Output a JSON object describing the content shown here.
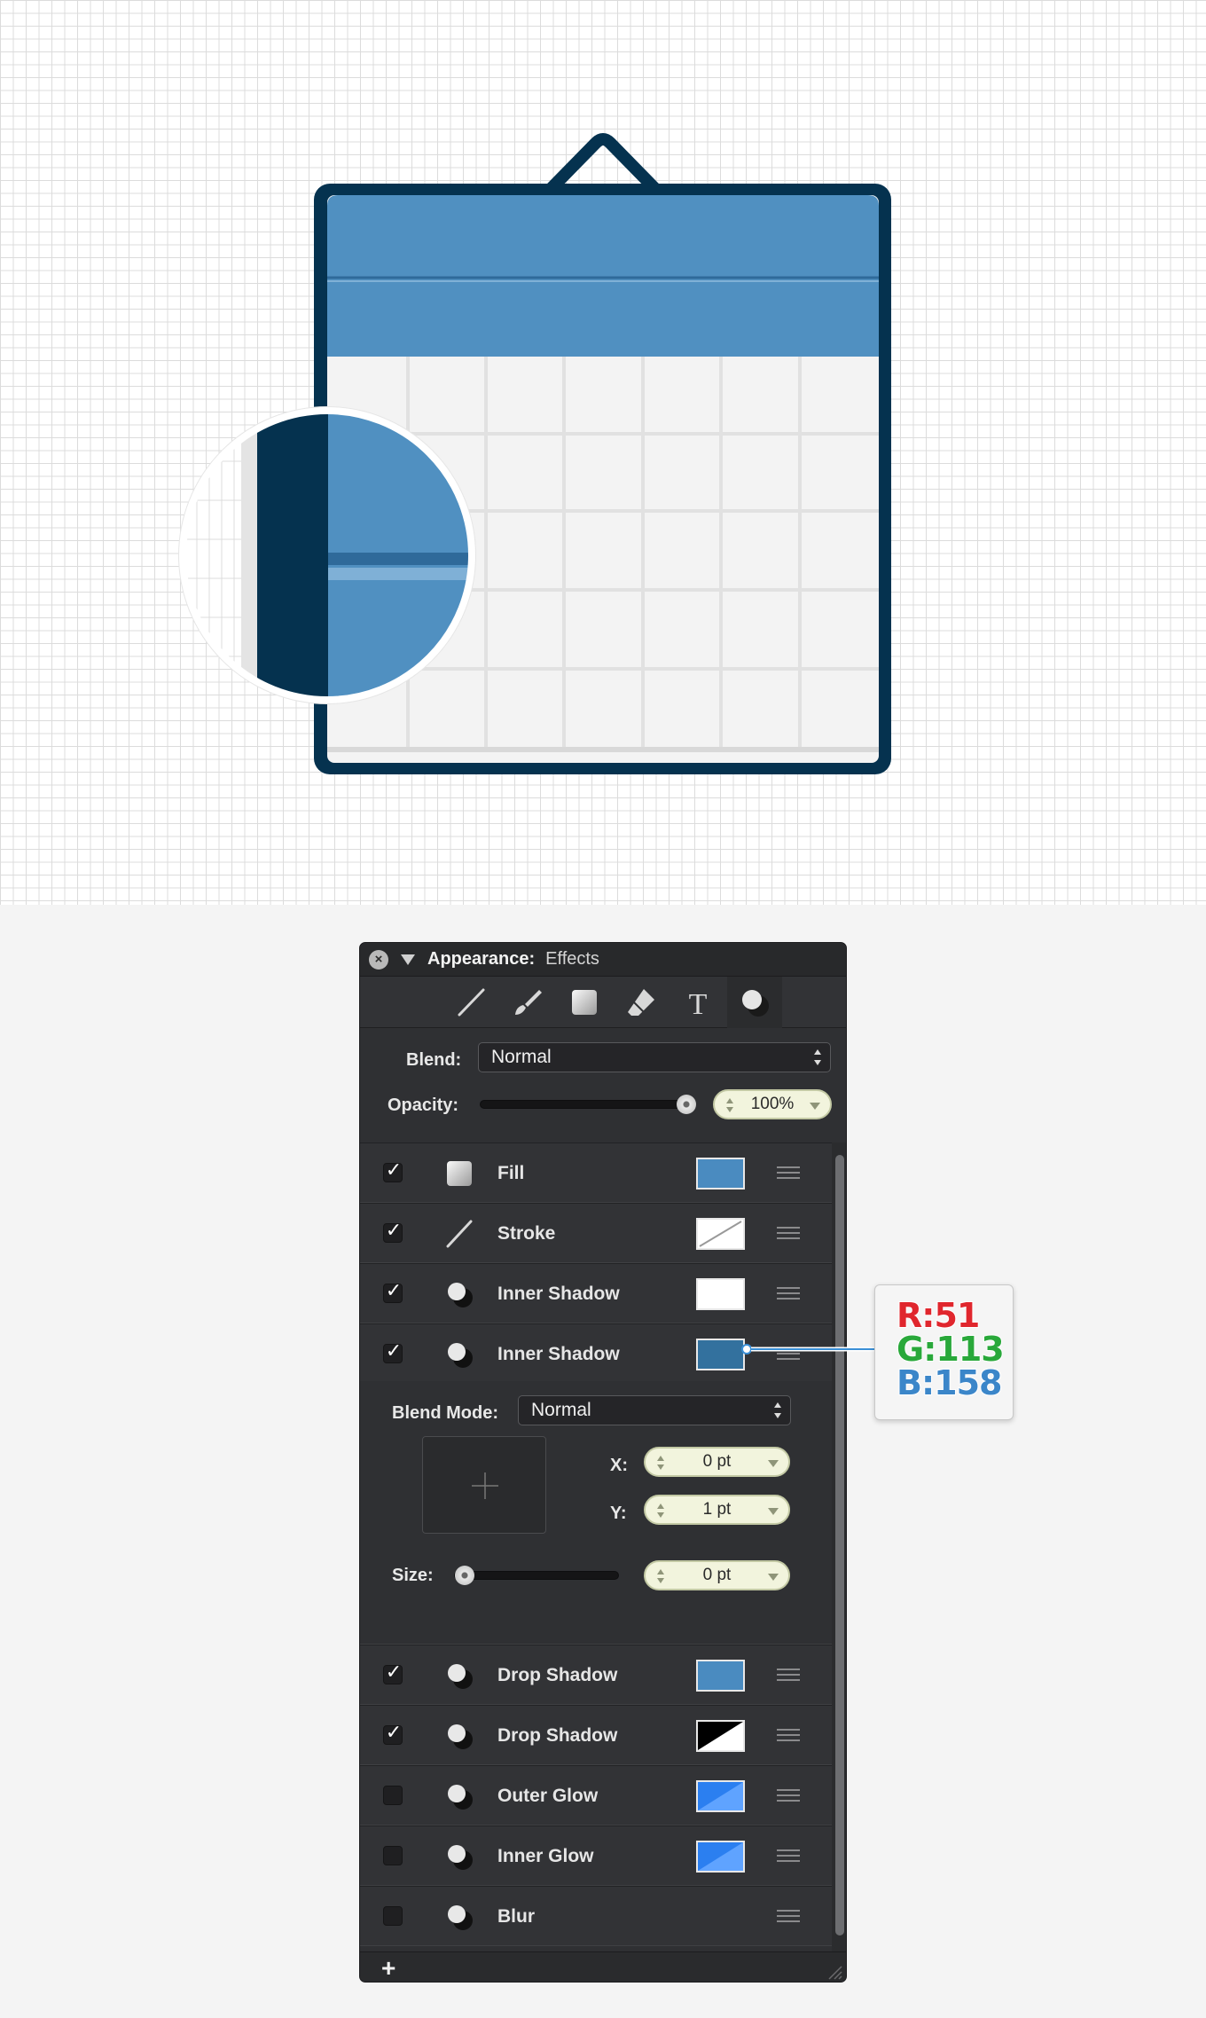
{
  "panel": {
    "title": "Appearance:",
    "subtitle": "Effects",
    "tabs": [
      "stroke-tab",
      "brush-tab",
      "fill-tab",
      "eraser-tab",
      "text-tab",
      "effects-tab"
    ],
    "blend_label": "Blend:",
    "blend_value": "Normal",
    "opacity_label": "Opacity:",
    "opacity_value": "100%",
    "opacity_level": 1.0,
    "rows_top": [
      {
        "checked": true,
        "icon": "fill-icon",
        "name": "Fill",
        "swatch": "#4a8bc0",
        "kind": "solid"
      },
      {
        "checked": true,
        "icon": "stroke-icon",
        "name": "Stroke",
        "swatch": "#ffffff",
        "kind": "slash"
      },
      {
        "checked": true,
        "icon": "effect-icon",
        "name": "Inner Shadow",
        "swatch": "#ffffff",
        "kind": "solid"
      },
      {
        "checked": true,
        "icon": "effect-icon",
        "name": "Inner Shadow",
        "swatch": "#33719e",
        "kind": "solid"
      }
    ],
    "detail": {
      "blend_mode_label": "Blend Mode:",
      "blend_mode_value": "Normal",
      "x_label": "X:",
      "x_value": "0 pt",
      "y_label": "Y:",
      "y_value": "1 pt",
      "size_label": "Size:",
      "size_value": "0 pt",
      "size_level": 0.0
    },
    "rows_bottom": [
      {
        "checked": true,
        "icon": "effect-icon",
        "name": "Drop Shadow",
        "swatch": "#4a8bc0",
        "kind": "solid"
      },
      {
        "checked": true,
        "icon": "effect-icon",
        "name": "Drop Shadow",
        "swatch": "#000000",
        "kind": "diagonal-bw"
      },
      {
        "checked": false,
        "icon": "effect-icon",
        "name": "Outer Glow",
        "swatch": "#2b7ff0",
        "kind": "diagonal-blue"
      },
      {
        "checked": false,
        "icon": "effect-icon",
        "name": "Inner Glow",
        "swatch": "#2b7ff0",
        "kind": "diagonal-blue"
      },
      {
        "checked": false,
        "icon": "effect-icon",
        "name": "Blur",
        "swatch": null,
        "kind": "none"
      }
    ],
    "add_label": "+"
  },
  "callout": {
    "r": "R:51",
    "g": "G:113",
    "b": "B:158",
    "r_color": "#e0262d",
    "g_color": "#29a83a",
    "b_color": "#3b86c9"
  },
  "colors": {
    "calendar_header": "#5090c1",
    "calendar_border": "#05324f",
    "calendar_body": "#f3f3f3",
    "panel_bg": "#2f3033"
  }
}
